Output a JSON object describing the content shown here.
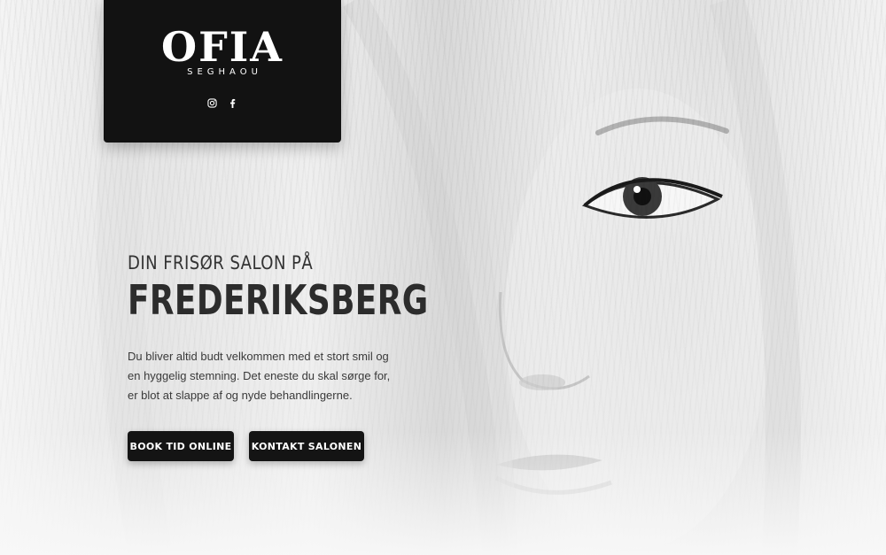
{
  "brand": {
    "logo": "OFIA",
    "tagline": "SEGHAOU"
  },
  "social": {
    "icons": [
      "instagram-icon",
      "facebook-icon"
    ]
  },
  "hero": {
    "kicker": "DIN FRISØR SALON PÅ",
    "headline": "FREDERIKSBERG",
    "intro": "Du bliver altid budt velkommen med et stort smil og en hyggelig stemning. Det eneste du skal sørge for, er blot at slappe af og nyde behandlingerne."
  },
  "buttons": {
    "book_label": "BOOK TID ONLINE",
    "contact_label": "KONTAKT SALONEN"
  },
  "colors": {
    "logo_box": "#121212",
    "button_bg": "#141414",
    "headline_text": "#2c2c2c",
    "background": "#f1f1f1"
  }
}
